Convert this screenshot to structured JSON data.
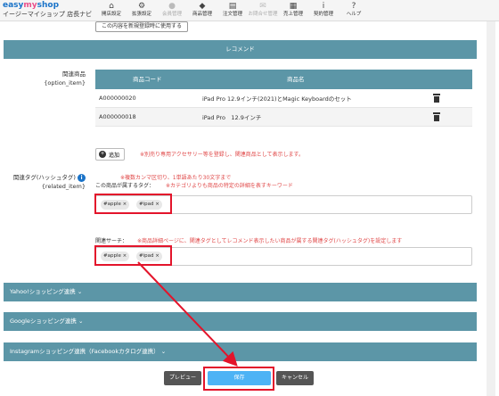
{
  "brand": {
    "logo_text_a": "easy",
    "logo_text_b": "my",
    "logo_text_c": "shop",
    "subtitle": "イージーマイショップ 店長ナビ"
  },
  "nav": [
    {
      "label": "開店設定",
      "icon": "home-icon",
      "glyph": "⌂",
      "enabled": true
    },
    {
      "label": "拡張設定",
      "icon": "gear-icon",
      "glyph": "⚙",
      "enabled": true
    },
    {
      "label": "会員管理",
      "icon": "user-icon",
      "glyph": "●",
      "enabled": false
    },
    {
      "label": "商品管理",
      "icon": "gift-icon",
      "glyph": "◆",
      "enabled": true
    },
    {
      "label": "注文管理",
      "icon": "document-icon",
      "glyph": "▤",
      "enabled": true
    },
    {
      "label": "お問合せ管理",
      "icon": "mail-icon",
      "glyph": "✉",
      "enabled": false
    },
    {
      "label": "売上管理",
      "icon": "calculator-icon",
      "glyph": "▦",
      "enabled": true
    },
    {
      "label": "契約管理",
      "icon": "info-icon",
      "glyph": "i",
      "enabled": true
    },
    {
      "label": "ヘルプ",
      "icon": "help-icon",
      "glyph": "?",
      "enabled": true
    }
  ],
  "copy_button": "この内容を新規登録時に使用する",
  "recommend": {
    "section_title": "レコメンド",
    "related_products_label": "関連商品",
    "related_products_key": "{option_item}",
    "table": {
      "headers": [
        "商品コード",
        "商品名"
      ],
      "rows": [
        {
          "code": "A000000020",
          "name": "iPad Pro 12.9インチ(2021)とMagic Keyboardのセット"
        },
        {
          "code": "A000000018",
          "name": "iPad Pro　12.9インチ"
        }
      ]
    },
    "add_button": "追加",
    "add_note": "※別売り専用アクセサリー等を登録し、関連商品として表示します。"
  },
  "related_tags": {
    "label": "関連タグ(ハッシュタグ)",
    "key": "{related_item}",
    "rule_note": "※複数カンマ区切り、1単語あたり30文字まで",
    "belongs_label": "この商品が属するタグ：",
    "belongs_note": "※カテゴリよりも商品の特定の詳細を表すキーワード",
    "belongs_tags": [
      "#apple",
      "#ipad"
    ],
    "search_label": "関連サーチ：",
    "search_note": "※商品詳細ページに、関連タグとしてレコメンド表示したい商品が属する関連タグ(ハッシュタグ)を設定します",
    "search_tags": [
      "#apple",
      "#ipad"
    ],
    "tag_remove": "×"
  },
  "collapsed_sections": [
    "Yahoo!ショッピング連携",
    "Googleショッピング連携",
    "Instagramショッピング連携（Facebookカタログ連携）"
  ],
  "chevron": "⌄",
  "buttons": {
    "preview": "プレビュー",
    "save": "保存",
    "cancel": "キャンセル"
  },
  "colors": {
    "section_bar": "#5c96a7",
    "save_button": "#4db3f5",
    "highlight": "#e3142b",
    "note_text": "#e04848"
  }
}
